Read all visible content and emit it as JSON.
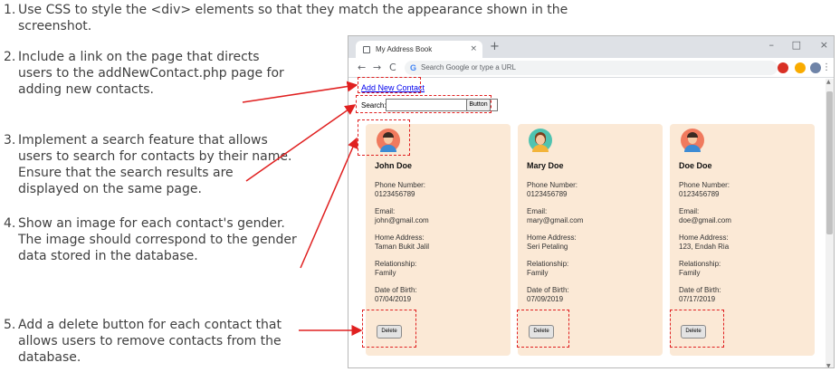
{
  "instructions": [
    {
      "num": "1.",
      "text": "Use CSS to style the <div> elements so that they match the appearance shown in the screenshot."
    },
    {
      "num": "2.",
      "text": "Include a link on the page that directs users to the addNewContact.php page for adding new contacts."
    },
    {
      "num": "3.",
      "text": "Implement a search feature that allows users to search for contacts by their name. Ensure that the search results are displayed on the same page."
    },
    {
      "num": "4.",
      "text": "Show an image for each contact's gender. The image should correspond to the gender data stored in the database."
    },
    {
      "num": "5.",
      "text": "Add a delete button for each contact that allows users to remove contacts from the database."
    }
  ],
  "browser": {
    "tab_title": "My Address Book",
    "tab_close": "×",
    "new_tab": "+",
    "window_controls": {
      "minimize": "–",
      "maximize": "□",
      "close": "×"
    },
    "nav": {
      "back": "←",
      "forward": "→",
      "reload": "C"
    },
    "omnibox_icon": "G",
    "omnibox_placeholder": "Search Google or type a URL",
    "menu": "⋮",
    "scroll_up": "▲",
    "scroll_down": "▼"
  },
  "page": {
    "add_link": "Add New Contact",
    "search_label": "Search:",
    "search_value": "",
    "search_button": "Button"
  },
  "labels": {
    "phone": "Phone Number:",
    "email": "Email:",
    "address": "Home Address:",
    "relationship": "Relationship:",
    "dob": "Date of Birth:",
    "delete": "Delete"
  },
  "contacts": [
    {
      "name": "John Doe",
      "phone": "0123456789",
      "email": "john@gmail.com",
      "address": "Taman Bukit Jalil",
      "relationship": "Family",
      "dob": "07/04/2019",
      "gender": "male",
      "avatar_bg": "#f07a5e"
    },
    {
      "name": "Mary Doe",
      "phone": "0123456789",
      "email": "mary@gmail.com",
      "address": "Seri Petaling",
      "relationship": "Family",
      "dob": "07/09/2019",
      "gender": "female",
      "avatar_bg": "#4fc3b0"
    },
    {
      "name": "Doe Doe",
      "phone": "0123456789",
      "email": "doe@gmail.com",
      "address": "123, Endah Ria",
      "relationship": "Family",
      "dob": "07/17/2019",
      "gender": "male",
      "avatar_bg": "#f07a5e"
    }
  ],
  "colors": {
    "annotation": "#e02020",
    "card_bg": "#fbe9d6",
    "link": "#0000ee"
  }
}
